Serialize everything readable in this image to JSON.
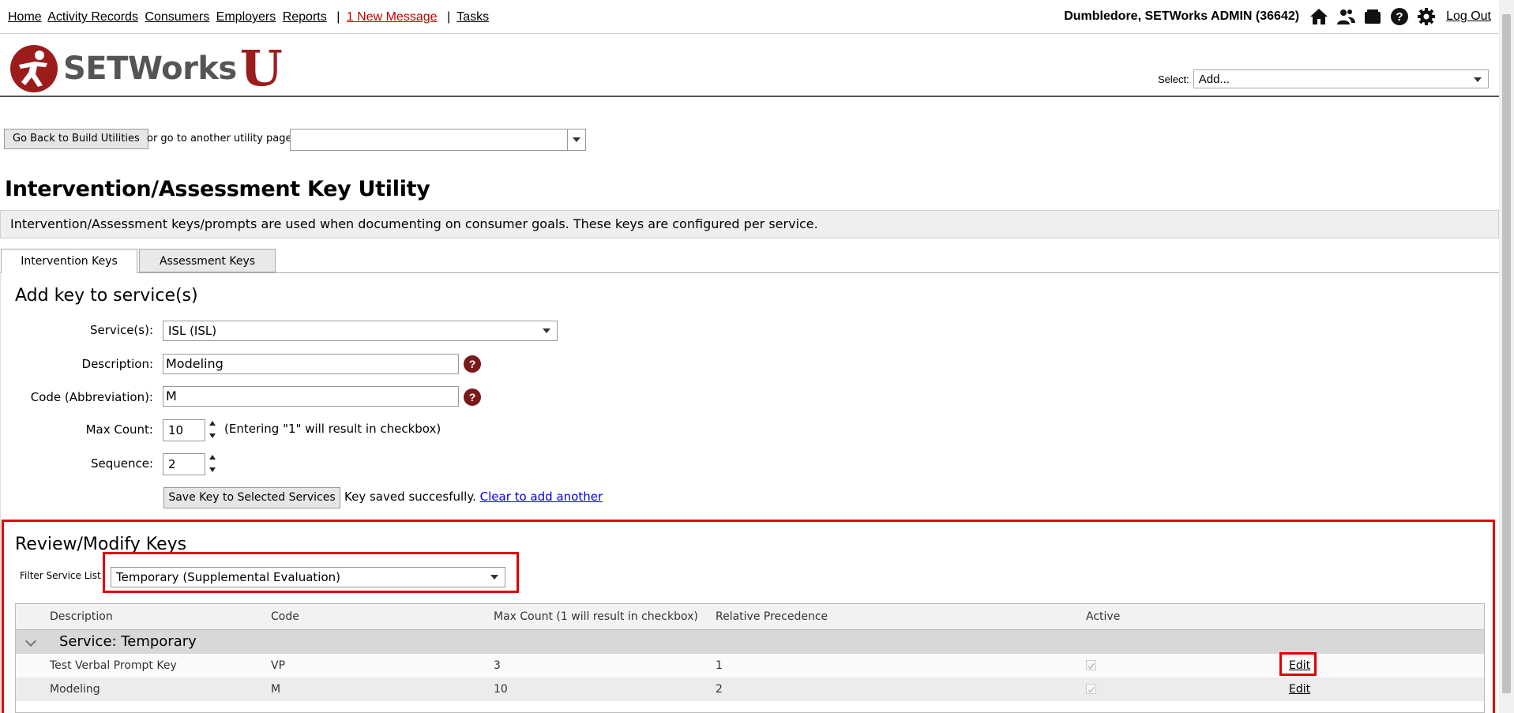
{
  "nav": {
    "items": [
      "Home",
      "Activity Records",
      "Consumers",
      "Employers",
      "Reports"
    ],
    "message": "1 New Message",
    "tasks": "Tasks",
    "user": "Dumbledore, SETWorks ADMIN  (36642)",
    "logout": "Log Out"
  },
  "logo": {
    "text": "SETWorks",
    "u": "U"
  },
  "select": {
    "label": "Select:",
    "value": "Add..."
  },
  "utility": {
    "back_label": "Go Back to Build Utilities",
    "goto_label": "or go to another utility page:",
    "goto_value": ""
  },
  "page_title": "Intervention/Assessment Key Utility",
  "info": "Intervention/Assessment keys/prompts are used when documenting on consumer goals. These keys are configured per service.",
  "tabs": [
    "Intervention Keys",
    "Assessment Keys"
  ],
  "form": {
    "heading": "Add key to service(s)",
    "services_label": "Service(s):",
    "services_value": "ISL (ISL)",
    "description_label": "Description:",
    "description_value": "Modeling",
    "code_label": "Code (Abbreviation):",
    "code_value": "M",
    "maxcount_label": "Max Count:",
    "maxcount_value": "10",
    "maxcount_note": "(Entering \"1\" will result in checkbox)",
    "sequence_label": "Sequence:",
    "sequence_value": "2",
    "save_label": "Save Key to Selected Services",
    "saved_msg": "Key saved succesfully.",
    "clear_link": "Clear to add another",
    "help_glyph": "?"
  },
  "review": {
    "heading": "Review/Modify Keys",
    "filter_label": "Filter Service List",
    "filter_value": "Temporary (Supplemental Evaluation)",
    "columns": [
      "Description",
      "Code",
      "Max Count (1 will result in checkbox)",
      "Relative Precedence",
      "Active"
    ],
    "group": "Service: Temporary",
    "rows": [
      {
        "description": "Test Verbal Prompt Key",
        "code": "VP",
        "max": "3",
        "precedence": "1",
        "active": true,
        "edit": "Edit"
      },
      {
        "description": "Modeling",
        "code": "M",
        "max": "10",
        "precedence": "2",
        "active": true,
        "edit": "Edit"
      }
    ]
  },
  "icons": [
    "home-icon",
    "users-icon",
    "folder-icon",
    "help-icon",
    "gear-icon"
  ],
  "colors": {
    "accent": "#9c1c1c",
    "highlight": "#e00000",
    "link": "#0000ee",
    "message": "#c00000"
  }
}
